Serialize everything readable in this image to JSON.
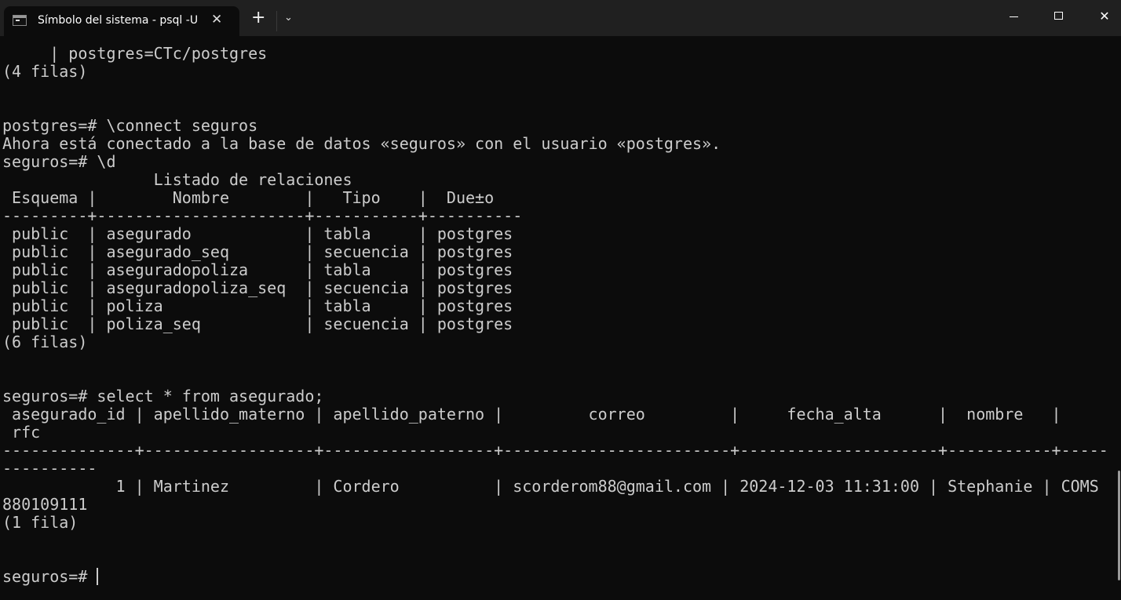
{
  "window": {
    "tab_title": "Símbolo del sistema - psql  -U",
    "new_tab_label": "+",
    "dropdown_label": "⌄",
    "close_tab_label": "✕",
    "minimize_label": "",
    "maximize_label": "",
    "close_label": "✕"
  },
  "terminal": {
    "lines": [
      "     | postgres=CTc/postgres",
      "(4 filas)",
      "",
      "",
      "postgres=# \\connect seguros",
      "Ahora está conectado a la base de datos «seguros» con el usuario «postgres».",
      "seguros=# \\d",
      "                Listado de relaciones",
      " Esquema |        Nombre        |   Tipo    |  Due±o",
      "---------+----------------------+-----------+----------",
      " public  | asegurado            | tabla     | postgres",
      " public  | asegurado_seq        | secuencia | postgres",
      " public  | aseguradopoliza      | tabla     | postgres",
      " public  | aseguradopoliza_seq  | secuencia | postgres",
      " public  | poliza               | tabla     | postgres",
      " public  | poliza_seq           | secuencia | postgres",
      "(6 filas)",
      "",
      "",
      "seguros=# select * from asegurado;",
      " asegurado_id | apellido_materno | apellido_paterno |         correo         |     fecha_alta      |  nombre   |",
      " rfc",
      "--------------+------------------+------------------+------------------------+---------------------+-----------+-----",
      "----------",
      "            1 | Martinez         | Cordero          | scorderom88@gmail.com | 2024-12-03 11:31:00 | Stephanie | COMS",
      "880109111",
      "(1 fila)",
      "",
      ""
    ],
    "prompt": "seguros=# "
  },
  "colors": {
    "background": "#0c0c0c",
    "text": "#cccccc",
    "titlebar": "#202020"
  }
}
